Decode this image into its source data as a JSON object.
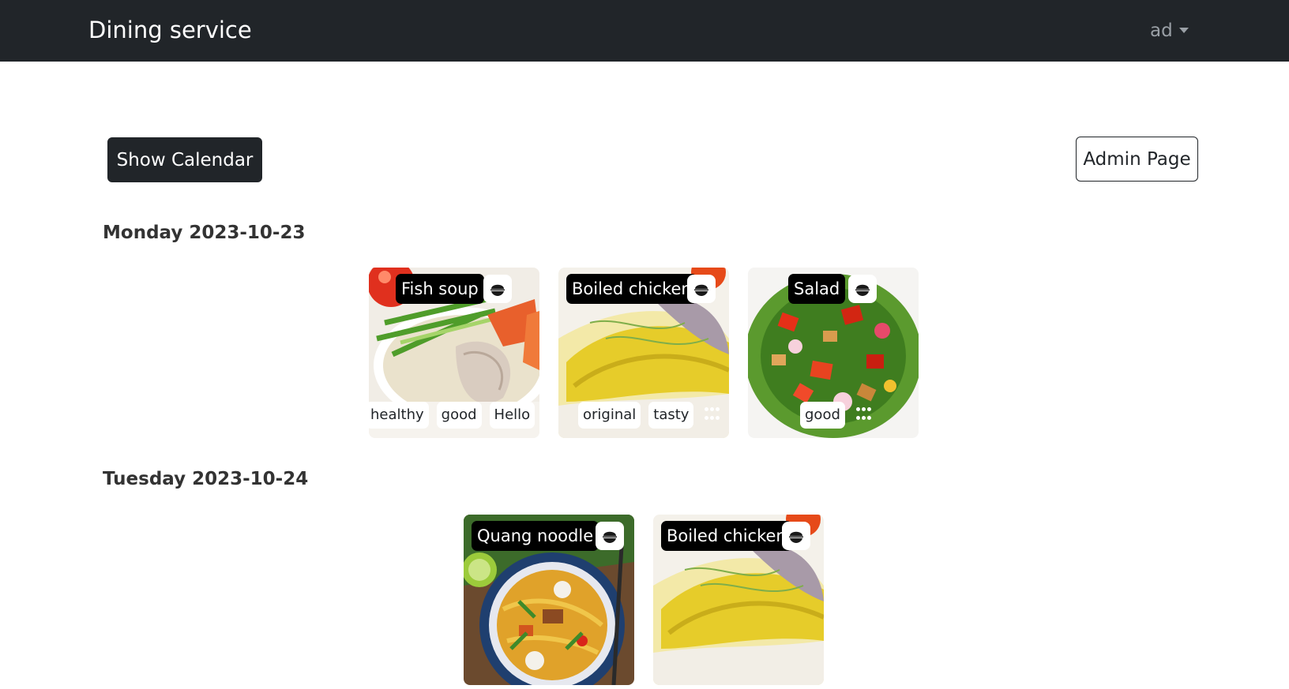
{
  "navbar": {
    "brand": "Dining service",
    "user": "ad"
  },
  "actions": {
    "show_calendar": "Show Calendar",
    "admin_page": "Admin Page"
  },
  "days": [
    {
      "label": "Monday 2023-10-23",
      "meals": [
        {
          "title": "Fish soup",
          "tags": [
            "healthy",
            "good",
            "Hello"
          ]
        },
        {
          "title": "Boiled chicken",
          "tags": [
            "original",
            "tasty"
          ]
        },
        {
          "title": "Salad",
          "tags": [
            "good"
          ]
        }
      ]
    },
    {
      "label": "Tuesday 2023-10-24",
      "meals": [
        {
          "title": "Quang noodle",
          "tags": []
        },
        {
          "title": "Boiled chicken",
          "tags": []
        }
      ]
    }
  ]
}
